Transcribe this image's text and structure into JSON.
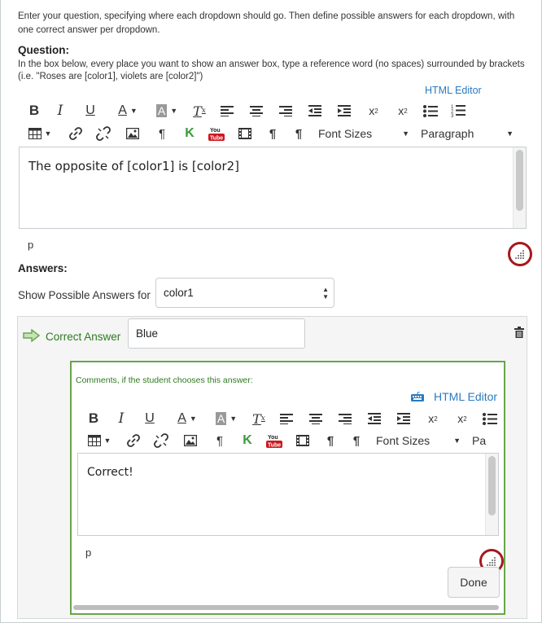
{
  "intro_text": "Enter your question, specifying where each dropdown should go. Then define possible answers for each dropdown, with one correct answer per dropdown.",
  "question": {
    "label": "Question:",
    "help_line1": "In the box below, every place you want to show an answer box, type a reference word (no spaces) surrounded by brackets",
    "help_line2": "(i.e. \"Roses are [color1], violets are [color2]\")",
    "html_editor_link": "HTML Editor",
    "font_sizes_label": "Font Sizes",
    "paragraph_label": "Paragraph",
    "content": "The opposite of [color1] is [color2]",
    "path": "p"
  },
  "answers": {
    "label": "Answers:",
    "show_label": "Show Possible Answers for",
    "selected_blank": "color1",
    "correct_answer_label": "Correct Answer",
    "answer_value": "Blue",
    "comments": {
      "label": "Comments, if the student chooses this answer:",
      "html_editor_link": "HTML Editor",
      "font_sizes_label": "Font Sizes",
      "paragraph_label": "Pa",
      "content": "Correct!",
      "path": "p",
      "done_label": "Done"
    }
  },
  "colors": {
    "link": "#2a7abf",
    "correct_green": "#2d7a1f",
    "comments_border": "#67a64a",
    "highlight_ring": "#a4191f",
    "youtube_red": "#cc181e"
  },
  "icons": [
    "bold-icon",
    "italic-icon",
    "underline-icon",
    "text-color-icon",
    "background-color-icon",
    "clear-formatting-icon",
    "align-left-icon",
    "align-center-icon",
    "align-right-icon",
    "outdent-icon",
    "indent-icon",
    "superscript-icon",
    "subscript-icon",
    "bullet-list-icon",
    "numbered-list-icon",
    "table-icon",
    "link-icon",
    "unlink-icon",
    "image-icon",
    "paragraph-mark-icon",
    "kaltura-icon",
    "youtube-icon",
    "media-icon",
    "ltr-icon",
    "rtl-icon",
    "trash-icon",
    "arrow-right-icon",
    "keyboard-icon",
    "resize-grip-icon"
  ]
}
